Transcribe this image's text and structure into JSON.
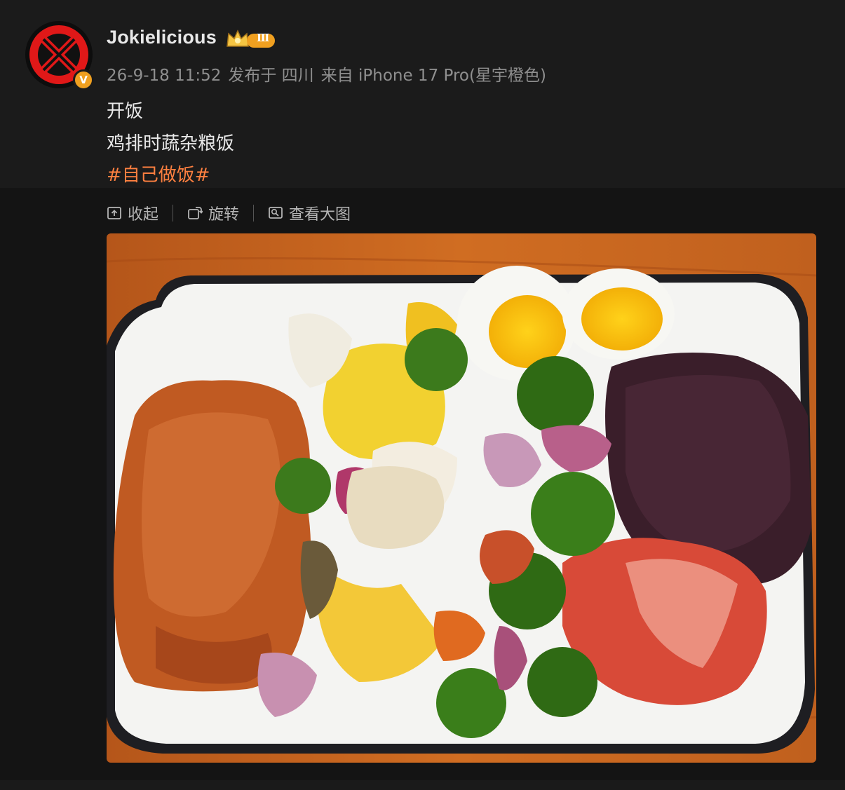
{
  "post": {
    "author": "Jokielicious",
    "verified_badge": "V",
    "level_badge": "Ⅲ",
    "timestamp": "26-9-18 11:52",
    "location": "发布于 四川",
    "device": "来自 iPhone 17 Pro(星宇橙色)",
    "text_line1": "开饭",
    "text_line2": "鸡排时蔬杂粮饭",
    "hashtag": "#自己做饭#"
  },
  "toolbar": {
    "collapse_label": "收起",
    "rotate_label": "旋转",
    "view_large_label": "查看大图"
  },
  "photo": {
    "alt": "Plate with chicken steak, roasted vegetables, boiled eggs, black rice and kimchi"
  },
  "colors": {
    "background": "#1a1a1a",
    "hashtag": "#ff8040",
    "meta_text": "#8f8f8f",
    "badge_gold": "#f0a020"
  },
  "icons": {
    "collapse": "collapse-icon",
    "rotate": "rotate-icon",
    "view_large": "view-large-icon",
    "crown": "crown-icon"
  }
}
